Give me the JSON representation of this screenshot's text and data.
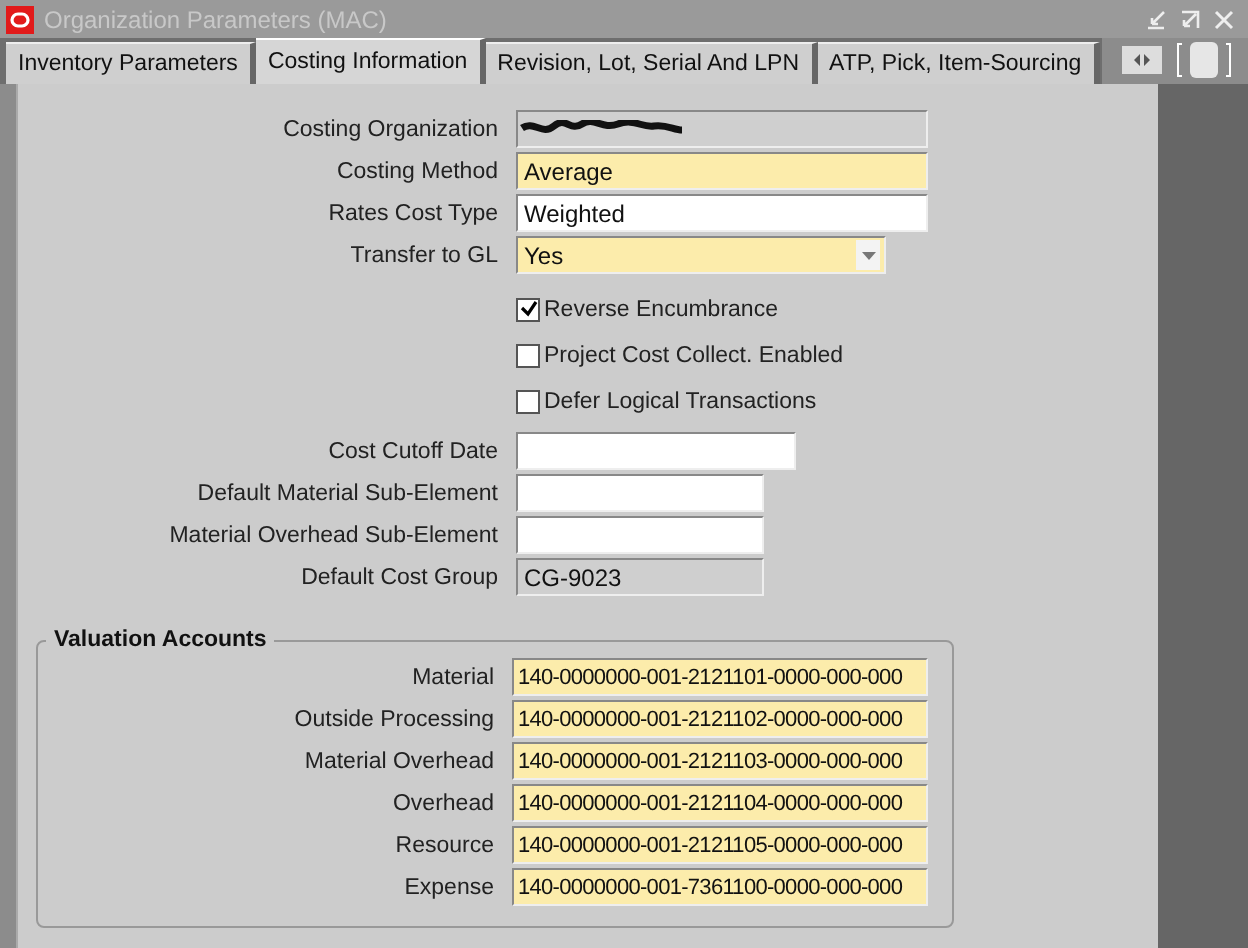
{
  "window": {
    "title": "Organization Parameters (MAC)"
  },
  "tabs": [
    {
      "label": "Inventory Parameters",
      "selected": false
    },
    {
      "label": "Costing Information",
      "selected": true
    },
    {
      "label": "Revision, Lot, Serial And LPN",
      "selected": false
    },
    {
      "label": "ATP, Pick, Item-Sourcing",
      "selected": false
    }
  ],
  "fields": [
    {
      "kind": "redacted",
      "label": "Costing Organization",
      "readonly": true,
      "required": false
    },
    {
      "kind": "text",
      "label": "Costing Method",
      "value": "Average",
      "readonly": false,
      "required": true
    },
    {
      "kind": "text",
      "label": "Rates Cost Type",
      "value": "Weighted",
      "readonly": false,
      "required": false
    },
    {
      "kind": "select",
      "label": "Transfer to GL",
      "value": "Yes",
      "readonly": false,
      "required": true
    },
    {
      "kind": "checkbox",
      "label": "Reverse Encumbrance",
      "checked": true
    },
    {
      "kind": "checkbox",
      "label": "Project Cost Collect. Enabled",
      "checked": false
    },
    {
      "kind": "checkbox",
      "label": "Defer Logical Transactions",
      "checked": false
    },
    {
      "kind": "text",
      "label": "Cost Cutoff Date",
      "readonly": false,
      "required": false
    },
    {
      "kind": "text",
      "label": "Default Material Sub-Element",
      "readonly": false,
      "required": false
    },
    {
      "kind": "text",
      "label": "Material Overhead Sub-Element",
      "readonly": false,
      "required": false
    },
    {
      "kind": "text",
      "label": "Default Cost Group",
      "value": "CG-9023",
      "readonly": true,
      "required": false
    }
  ],
  "valuation_accounts": {
    "title": "Valuation Accounts",
    "accounts": [
      {
        "label": "Material",
        "value": "140-0000000-001-2121101-0000-000-000",
        "required": true
      },
      {
        "label": "Outside Processing",
        "value": "140-0000000-001-2121102-0000-000-000",
        "required": true
      },
      {
        "label": "Material Overhead",
        "value": "140-0000000-001-2121103-0000-000-000",
        "required": true
      },
      {
        "label": "Overhead",
        "value": "140-0000000-001-2121104-0000-000-000",
        "required": true
      },
      {
        "label": "Resource",
        "value": "140-0000000-001-2121105-0000-000-000",
        "required": true
      },
      {
        "label": "Expense",
        "value": "140-0000000-001-7361100-0000-000-000",
        "required": true
      }
    ]
  }
}
